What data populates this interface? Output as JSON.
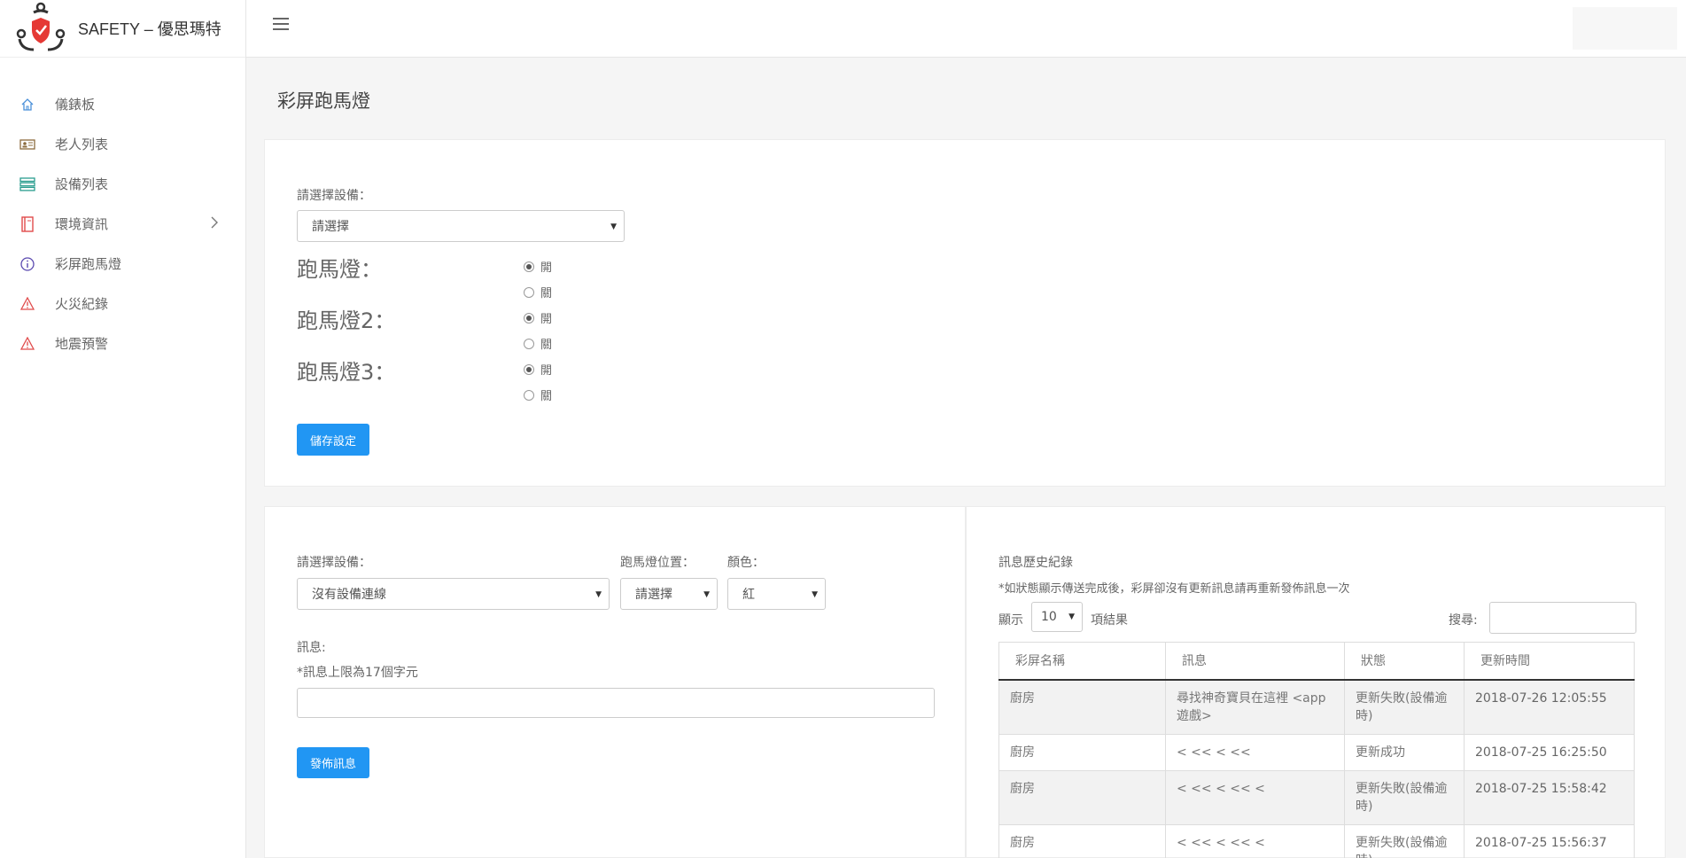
{
  "brand": {
    "name": "SAFETY – 優思瑪特"
  },
  "sidebar": {
    "items": [
      {
        "label": "儀錶板",
        "icon": "home-icon",
        "color": "#4a90d9"
      },
      {
        "label": "老人列表",
        "icon": "id-card-icon",
        "color": "#8b6b3d"
      },
      {
        "label": "設備列表",
        "icon": "list-icon",
        "color": "#2a9d8f"
      },
      {
        "label": "環境資訊",
        "icon": "book-icon",
        "color": "#e04b4b"
      },
      {
        "label": "彩屏跑馬燈",
        "icon": "info-icon",
        "color": "#5b4ab0"
      },
      {
        "label": "火災紀錄",
        "icon": "warning-icon",
        "color": "#e04b4b"
      },
      {
        "label": "地震預警",
        "icon": "warning-icon",
        "color": "#e04b4b"
      }
    ]
  },
  "page": {
    "title": "彩屏跑馬燈"
  },
  "settings": {
    "device_label": "請選擇設備：",
    "device_select": "請選擇",
    "marquees": [
      {
        "label": "跑馬燈：",
        "on": "開",
        "off": "關",
        "selected": "on"
      },
      {
        "label": "跑馬燈2：",
        "on": "開",
        "off": "關",
        "selected": "on"
      },
      {
        "label": "跑馬燈3：",
        "on": "開",
        "off": "關",
        "selected": "on"
      }
    ],
    "save_button": "儲存設定"
  },
  "publish": {
    "device_label": "請選擇設備：",
    "device_select": "沒有設備連線",
    "position_label": "跑馬燈位置：",
    "position_select": "請選擇",
    "color_label": "顏色：",
    "color_select": "紅",
    "message_label": "訊息:",
    "message_hint": "*訊息上限為17個字元",
    "message_value": "",
    "publish_button": "發佈訊息"
  },
  "history": {
    "title": "訊息歷史紀錄",
    "note": "*如狀態顯示傳送完成後，彩屏卻沒有更新訊息請再重新發佈訊息一次",
    "show_prefix": "顯示",
    "page_size": "10",
    "show_suffix": "項結果",
    "search_label": "搜尋:",
    "search_value": "",
    "columns": [
      "彩屏名稱",
      "訊息",
      "狀態",
      "更新時間"
    ],
    "rows": [
      {
        "name": "廚房",
        "message": "尋找神奇寶貝在這裡 <app遊戲>",
        "status": "更新失敗(設備逾時)",
        "time": "2018-07-26 12:05:55"
      },
      {
        "name": "廚房",
        "message": "< << < <<",
        "status": "更新成功",
        "time": "2018-07-25 16:25:50"
      },
      {
        "name": "廚房",
        "message": "< << < << <",
        "status": "更新失敗(設備逾時)",
        "time": "2018-07-25 15:58:42"
      },
      {
        "name": "廚房",
        "message": "< << < << <",
        "status": "更新失敗(設備逾時)",
        "time": "2018-07-25 15:56:37"
      }
    ]
  }
}
